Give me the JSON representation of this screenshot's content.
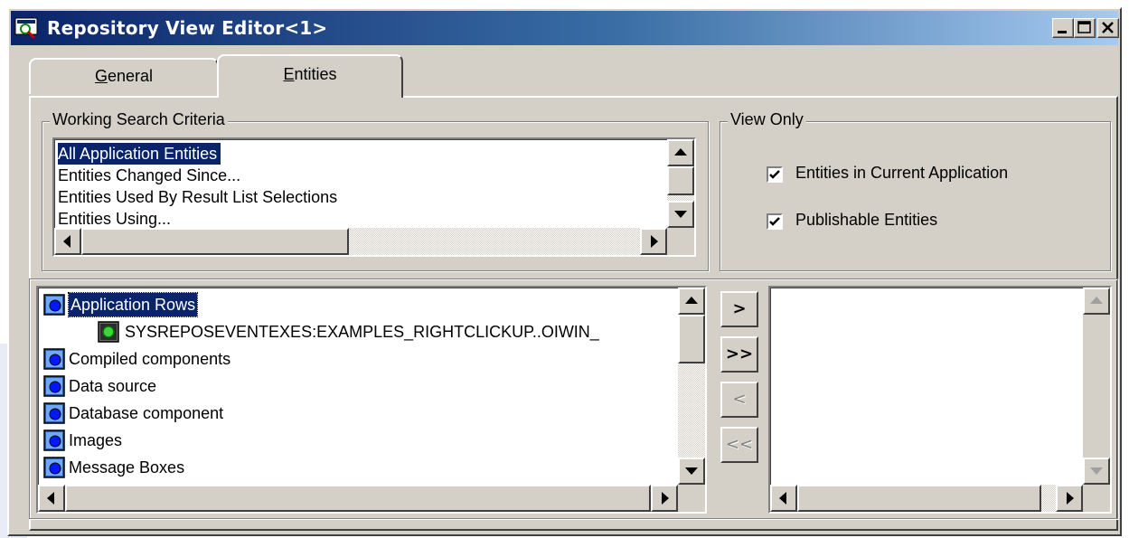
{
  "window": {
    "title": "Repository View Editor<1>",
    "controls": [
      "minimize-icon",
      "maximize-icon",
      "close-icon"
    ]
  },
  "tabs": [
    {
      "label": "General",
      "mnemonic": "G",
      "rest": "eneral",
      "active": false
    },
    {
      "label": "Entities",
      "mnemonic": "E",
      "rest": "ntities",
      "active": true
    }
  ],
  "search_criteria": {
    "title": "Working Search Criteria",
    "items": [
      "All Application Entities",
      "Entities Changed Since...",
      "Entities Used By Result List Selections",
      "Entities Using..."
    ],
    "selected_index": 0
  },
  "view_only": {
    "title": "View Only",
    "options": [
      {
        "label": "Entities in Current Application",
        "checked": true
      },
      {
        "label": "Publishable Entities",
        "checked": true
      }
    ]
  },
  "tree": {
    "rows": [
      {
        "label": "Application Rows",
        "level": 0,
        "icon": "folder-entity-icon",
        "focused": true
      },
      {
        "label": "SYSREPOSEVENTEXES:EXAMPLES_RIGHTCLICKUP..OIWIN_",
        "level": 1,
        "icon": "entity-item-icon",
        "focused": false
      },
      {
        "label": "Compiled components",
        "level": 0,
        "icon": "folder-entity-icon",
        "focused": false
      },
      {
        "label": "Data source",
        "level": 0,
        "icon": "folder-entity-icon",
        "focused": false
      },
      {
        "label": "Database component",
        "level": 0,
        "icon": "folder-entity-icon",
        "focused": false
      },
      {
        "label": "Images",
        "level": 0,
        "icon": "folder-entity-icon",
        "focused": false
      },
      {
        "label": "Message Boxes",
        "level": 0,
        "icon": "folder-entity-icon",
        "focused": false
      }
    ]
  },
  "move_buttons": [
    {
      "label": ">",
      "enabled": true
    },
    {
      "label": ">>",
      "enabled": true
    },
    {
      "label": "<",
      "enabled": false
    },
    {
      "label": "<<",
      "enabled": false
    }
  ],
  "colors": {
    "face": "#d4d0c8",
    "title_start": "#0a246a",
    "title_end": "#a6caf0",
    "selection": "#0a246a"
  }
}
